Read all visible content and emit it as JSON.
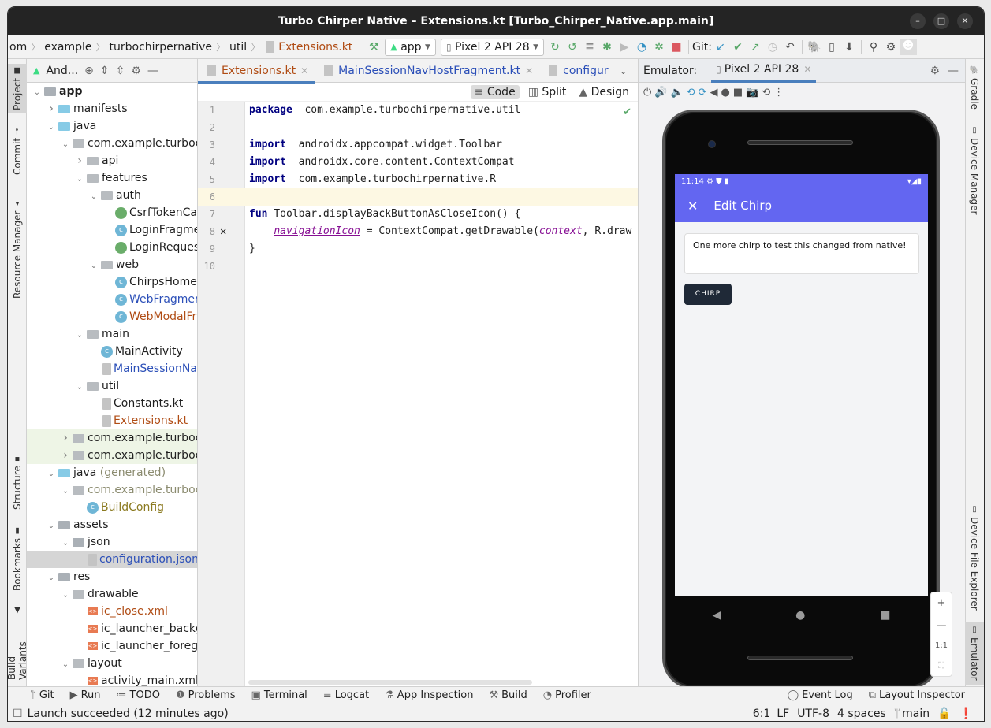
{
  "window": {
    "title": "Turbo Chirper Native – Extensions.kt [Turbo_Chirper_Native.app.main]",
    "controls": {
      "minimize": "–",
      "maximize": "□",
      "close": "✕"
    }
  },
  "navbar": {
    "breadcrumbs": [
      "om",
      "example",
      "turbochirpernative",
      "util",
      "Extensions.kt"
    ],
    "run_config": "app",
    "device": "Pixel 2 API 28",
    "git_label": "Git:",
    "icons": [
      "hammer-icon",
      "rerun-icon",
      "apply-changes-icon",
      "apply-code-icon",
      "debug-icon",
      "coverage-icon",
      "profile-icon",
      "attach-debugger-icon",
      "stop-icon",
      "git-update-icon",
      "git-commit-icon",
      "git-push-icon",
      "git-history-icon",
      "git-rollback-icon",
      "sync-gradle-icon",
      "device-manager-icon",
      "sdk-manager-icon",
      "search-icon",
      "settings-icon",
      "user-avatar-icon"
    ]
  },
  "left_strip": {
    "tabs": [
      {
        "label": "Project",
        "active": true
      },
      {
        "label": "Commit",
        "active": false
      },
      {
        "label": "Resource Manager",
        "active": false
      },
      {
        "label": "Structure",
        "active": false
      },
      {
        "label": "Bookmarks",
        "active": false
      },
      {
        "label": "Build Variants",
        "active": false
      }
    ]
  },
  "project": {
    "view_selector": "And...",
    "tree": [
      {
        "label": "app",
        "indent": 0,
        "chev": "v",
        "icon": "module",
        "style": "bold"
      },
      {
        "label": "manifests",
        "indent": 1,
        "chev": ">",
        "icon": "folder-blue"
      },
      {
        "label": "java",
        "indent": 1,
        "chev": "v",
        "icon": "folder-blue"
      },
      {
        "label": "com.example.turboc",
        "indent": 2,
        "chev": "v",
        "icon": "package"
      },
      {
        "label": "api",
        "indent": 3,
        "chev": ">",
        "icon": "package"
      },
      {
        "label": "features",
        "indent": 3,
        "chev": "v",
        "icon": "package"
      },
      {
        "label": "auth",
        "indent": 4,
        "chev": "v",
        "icon": "package"
      },
      {
        "label": "CsrfTokenCa",
        "indent": 5,
        "chev": "",
        "icon": "interface"
      },
      {
        "label": "LoginFragme",
        "indent": 5,
        "chev": "",
        "icon": "class"
      },
      {
        "label": "LoginReques",
        "indent": 5,
        "chev": "",
        "icon": "interface"
      },
      {
        "label": "web",
        "indent": 4,
        "chev": "v",
        "icon": "package"
      },
      {
        "label": "ChirpsHomeF",
        "indent": 5,
        "chev": "",
        "icon": "class"
      },
      {
        "label": "WebFragmer",
        "indent": 5,
        "chev": "",
        "icon": "class",
        "style": "blue"
      },
      {
        "label": "WebModalFr",
        "indent": 5,
        "chev": "",
        "icon": "class",
        "style": "modified"
      },
      {
        "label": "main",
        "indent": 3,
        "chev": "v",
        "icon": "package"
      },
      {
        "label": "MainActivity",
        "indent": 4,
        "chev": "",
        "icon": "class"
      },
      {
        "label": "MainSessionNav",
        "indent": 4,
        "chev": "",
        "icon": "kt-file",
        "style": "blue"
      },
      {
        "label": "util",
        "indent": 3,
        "chev": "v",
        "icon": "package"
      },
      {
        "label": "Constants.kt",
        "indent": 4,
        "chev": "",
        "icon": "kt-file"
      },
      {
        "label": "Extensions.kt",
        "indent": 4,
        "chev": "",
        "icon": "kt-file",
        "style": "modified"
      },
      {
        "label": "com.example.turboc",
        "indent": 2,
        "chev": ">",
        "icon": "package",
        "bg": "green"
      },
      {
        "label": "com.example.turboc",
        "indent": 2,
        "chev": ">",
        "icon": "package",
        "bg": "green"
      },
      {
        "label": "java",
        "indent": 1,
        "chev": "v",
        "icon": "folder-generated",
        "suffix": " (generated)"
      },
      {
        "label": "com.example.turboc",
        "indent": 2,
        "chev": "v",
        "icon": "package",
        "style": "generated"
      },
      {
        "label": "BuildConfig",
        "indent": 3,
        "chev": "",
        "icon": "class",
        "style": "olive"
      },
      {
        "label": "assets",
        "indent": 1,
        "chev": "v",
        "icon": "folder-res"
      },
      {
        "label": "json",
        "indent": 2,
        "chev": "v",
        "icon": "folder"
      },
      {
        "label": "configuration.json",
        "indent": 3,
        "chev": "",
        "icon": "json-file",
        "style": "blue",
        "selected": true
      },
      {
        "label": "res",
        "indent": 1,
        "chev": "v",
        "icon": "folder-res"
      },
      {
        "label": "drawable",
        "indent": 2,
        "chev": "v",
        "icon": "package"
      },
      {
        "label": "ic_close.xml",
        "indent": 3,
        "chev": "",
        "icon": "xml-file",
        "style": "modified"
      },
      {
        "label": "ic_launcher_backg",
        "indent": 3,
        "chev": "",
        "icon": "xml-file"
      },
      {
        "label": "ic_launcher_foregr",
        "indent": 3,
        "chev": "",
        "icon": "xml-file"
      },
      {
        "label": "layout",
        "indent": 2,
        "chev": "v",
        "icon": "package"
      },
      {
        "label": "activity_main.xml",
        "indent": 3,
        "chev": "",
        "icon": "xml-file"
      }
    ]
  },
  "editor": {
    "tabs": [
      {
        "label": "Extensions.kt",
        "active": true,
        "style": "modified"
      },
      {
        "label": "MainSessionNavHostFragment.kt",
        "active": false,
        "style": "blue"
      },
      {
        "label": "configur",
        "active": false,
        "style": "blue"
      }
    ],
    "view_modes": [
      "Code",
      "Split",
      "Design"
    ],
    "active_view": "Code",
    "lines": [
      {
        "n": "1",
        "parts": [
          [
            "kw2",
            "package"
          ],
          [
            "",
            "  com.example.turbochirpernative.util"
          ]
        ]
      },
      {
        "n": "2",
        "parts": []
      },
      {
        "n": "3",
        "parts": [
          [
            "kw2",
            "import"
          ],
          [
            "",
            "  androidx.appcompat.widget.Toolbar"
          ]
        ]
      },
      {
        "n": "4",
        "parts": [
          [
            "kw2",
            "import"
          ],
          [
            "",
            "  androidx.core.content.ContextCompat"
          ]
        ]
      },
      {
        "n": "5",
        "parts": [
          [
            "kw2",
            "import"
          ],
          [
            "",
            "  com.example.turbochirpernative.R"
          ]
        ]
      },
      {
        "n": "6",
        "parts": [],
        "current": true
      },
      {
        "n": "7",
        "parts": [
          [
            "kw2",
            "fun"
          ],
          [
            "",
            " Toolbar.displayBackButtonAsCloseIcon() {"
          ]
        ]
      },
      {
        "n": "8",
        "parts": [
          [
            "",
            "    "
          ],
          [
            "prop",
            "navigationIcon"
          ],
          [
            "",
            " = ContextCompat.getDrawable("
          ],
          [
            "ital",
            "context"
          ],
          [
            "",
            ", R.draw"
          ]
        ],
        "marker": "✕"
      },
      {
        "n": "9",
        "parts": [
          [
            "",
            "}"
          ]
        ]
      },
      {
        "n": "10",
        "parts": []
      }
    ]
  },
  "emulator": {
    "label": "Emulator:",
    "device_tab": "Pixel 2 API 28",
    "phone": {
      "time": "11:14",
      "title": "Edit Chirp",
      "close_glyph": "✕",
      "chirp_text": "One more chirp to test this changed from native!",
      "button": "CHIRP",
      "theme_color": "#6366f1",
      "button_color": "#1f2937"
    },
    "zoom_controls": [
      "+",
      "—",
      "1:1",
      "⛶"
    ]
  },
  "right_strip": {
    "tabs": [
      {
        "label": "Gradle",
        "active": false
      },
      {
        "label": "Device Manager",
        "active": false
      },
      {
        "label": "Device File Explorer",
        "active": false
      },
      {
        "label": "Emulator",
        "active": true
      }
    ]
  },
  "bottom_tools": {
    "left": [
      {
        "icon": "git-branch-icon",
        "glyph": "ᛘ",
        "label": "Git"
      },
      {
        "icon": "run-icon",
        "glyph": "▶",
        "label": "Run"
      },
      {
        "icon": "todo-icon",
        "glyph": "≔",
        "label": "TODO"
      },
      {
        "icon": "problems-icon",
        "glyph": "❶",
        "label": "Problems"
      },
      {
        "icon": "terminal-icon",
        "glyph": "▣",
        "label": "Terminal"
      },
      {
        "icon": "logcat-icon",
        "glyph": "≡",
        "label": "Logcat"
      },
      {
        "icon": "app-inspection-icon",
        "glyph": "⚗",
        "label": "App Inspection"
      },
      {
        "icon": "build-icon",
        "glyph": "⚒",
        "label": "Build"
      },
      {
        "icon": "profiler-icon",
        "glyph": "◔",
        "label": "Profiler"
      }
    ],
    "right": [
      {
        "icon": "event-log-icon",
        "glyph": "◯",
        "label": "Event Log"
      },
      {
        "icon": "layout-inspector-icon",
        "glyph": "⧉",
        "label": "Layout Inspector"
      }
    ]
  },
  "status": {
    "message": "Launch succeeded (12 minutes ago)",
    "position": "6:1",
    "line_sep": "LF",
    "encoding": "UTF-8",
    "indent": "4 spaces",
    "branch": "main"
  }
}
